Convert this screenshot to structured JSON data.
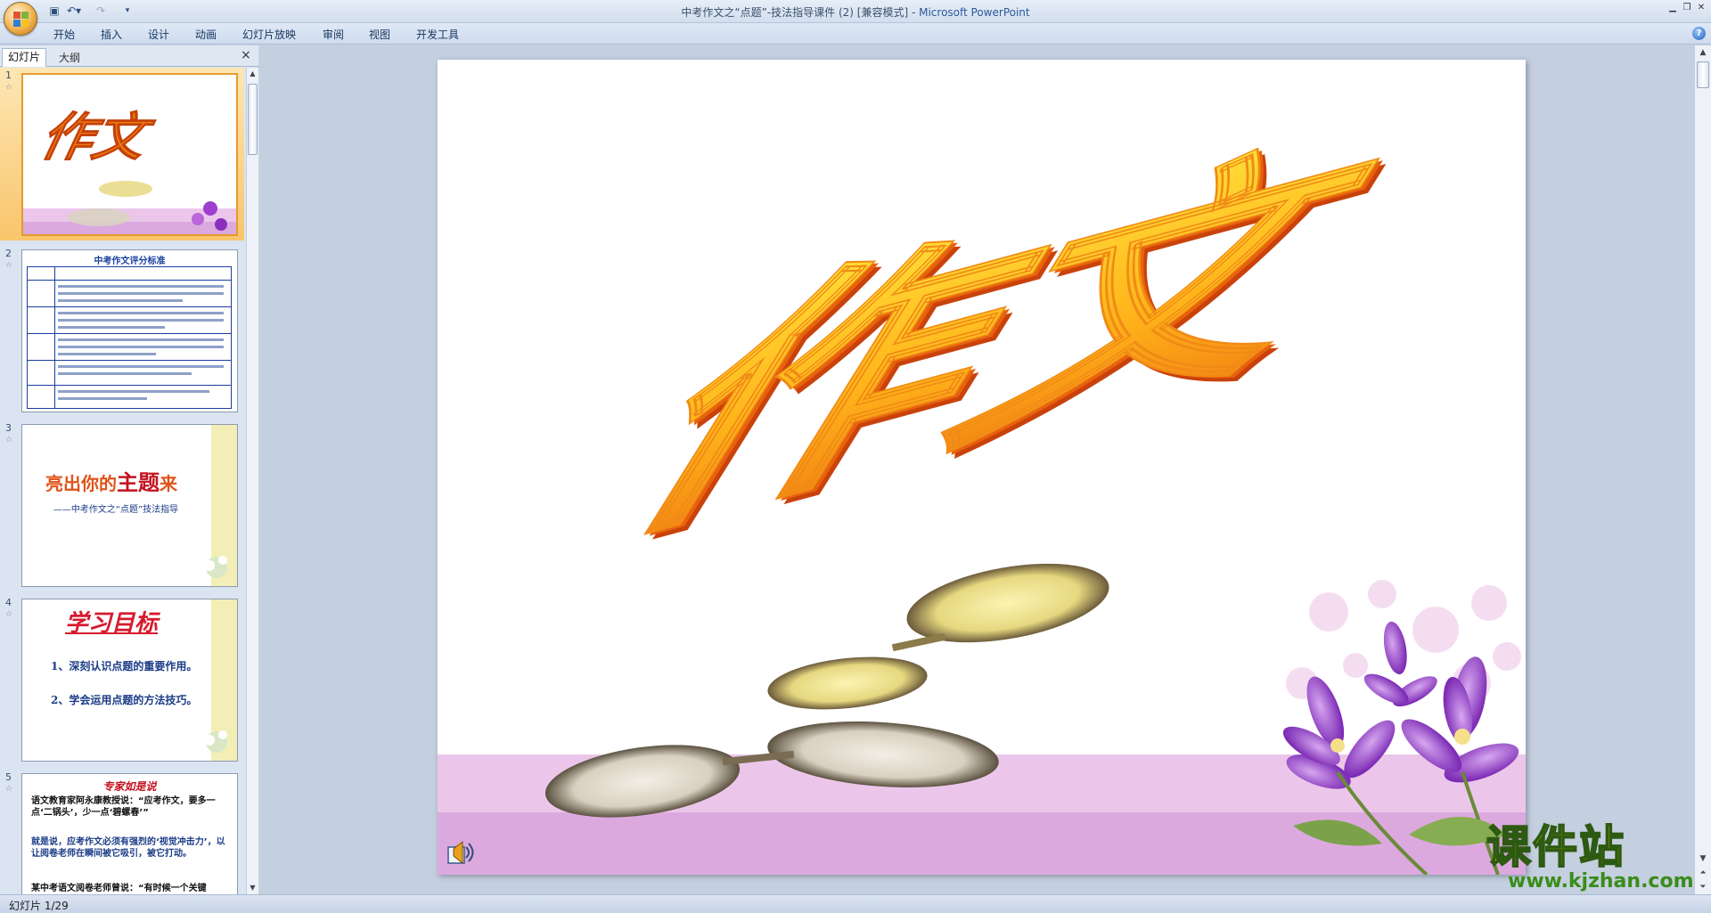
{
  "window": {
    "title": "中考作文之“点题”-技法指导课件 (2) [兼容模式]",
    "app_name": "Microsoft PowerPoint",
    "separator": " - "
  },
  "ribbon": {
    "tabs": [
      "开始",
      "插入",
      "设计",
      "动画",
      "幻灯片放映",
      "审阅",
      "视图",
      "开发工具"
    ]
  },
  "left_pane": {
    "tab_slides": "幻灯片",
    "tab_outline": "大纲",
    "close_glyph": "×"
  },
  "thumbnails": [
    {
      "number": "1",
      "title": "作文"
    },
    {
      "number": "2",
      "title": "中考作文评分标准"
    },
    {
      "number": "3",
      "title_a": "亮出你的",
      "title_b": "主题",
      "title_c": "来",
      "subtitle": "——中考作文之“点题”技法指导"
    },
    {
      "number": "4",
      "title": "学习目标",
      "items": [
        "1、深刻认识点题的重要作用。",
        "2、学会运用点题的方法技巧。"
      ]
    },
    {
      "number": "5",
      "title": "专家如是说",
      "text_a": "语文教育家阿永康教授说：“应考作文，要多一点‘二锅头’，少一点‘碧螺春’”",
      "text_b": "就是说，应考作文必须有强烈的‘视觉冲击力’，以让阅卷老师在瞬间被它吸引，被它打动。",
      "text_c": "某中考语文阅卷老师曾说：“有时候一个关键词……"
    }
  ],
  "slide": {
    "title": "作文"
  },
  "status": {
    "slide_indicator": "幻灯片 1/29"
  },
  "watermark": {
    "main": "课件站",
    "url": "www.kjzhan.com"
  },
  "colors": {
    "title_orange": "#f07a12",
    "title_yellow": "#ffd21e",
    "floor_pink": "#ebc6ea",
    "selection": "#f9c56c"
  }
}
